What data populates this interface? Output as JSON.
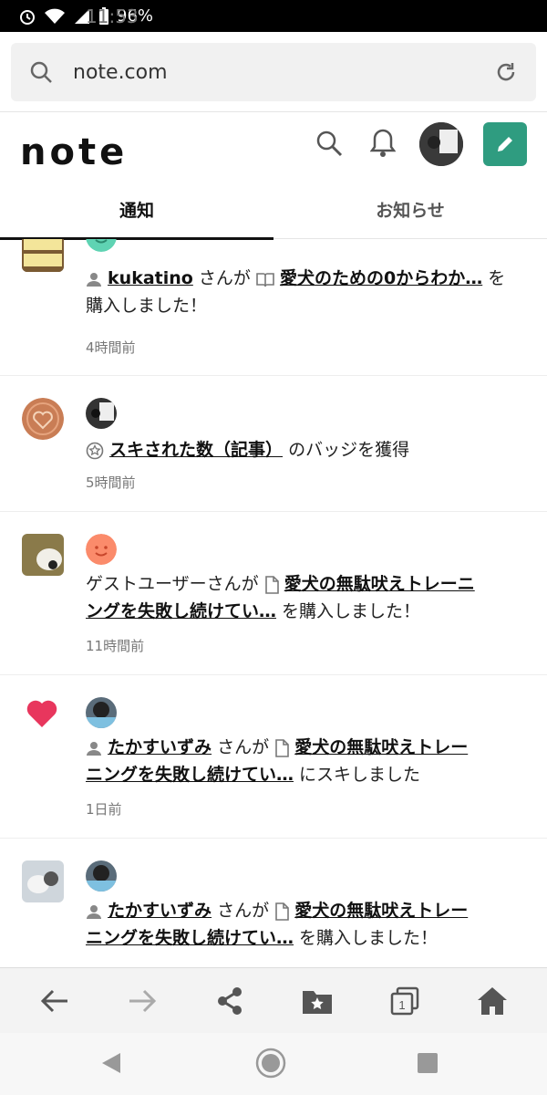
{
  "status": {
    "time": "11:53",
    "battery": "96%"
  },
  "browser": {
    "url": "note.com"
  },
  "header": {
    "logo": "note"
  },
  "tabs": [
    {
      "label": "通知"
    },
    {
      "label": "お知らせ"
    }
  ],
  "notifications": [
    {
      "user": "kukatino",
      "san": " さんが ",
      "title": "愛犬のための0からわか…",
      "suffix": " を",
      "line2": "購入しました！",
      "time": "4時間前"
    },
    {
      "title": "スキされた数（記事）",
      "suffix": " のバッジを獲得",
      "time": "5時間前"
    },
    {
      "prefix": "ゲストユーザーさんが ",
      "title1": "愛犬の無駄吠えトレーニ",
      "title2": "ングを失敗し続けてい…",
      "suffix": " を購入しました！",
      "time": "11時間前"
    },
    {
      "user": "たかすいずみ",
      "san": " さんが ",
      "title1": "愛犬の無駄吠えトレー",
      "title2": "ニングを失敗し続けてい…",
      "suffix": " にスキしました",
      "time": "1日前"
    },
    {
      "user": "たかすいずみ",
      "san": " さんが ",
      "title1": "愛犬の無駄吠えトレー",
      "title2": "ニングを失敗し続けてい…",
      "suffix": " を購入しました！"
    }
  ],
  "colors": {
    "accent": "#2f9c80",
    "heart": "#e8365d",
    "badge": "#c97d55"
  }
}
